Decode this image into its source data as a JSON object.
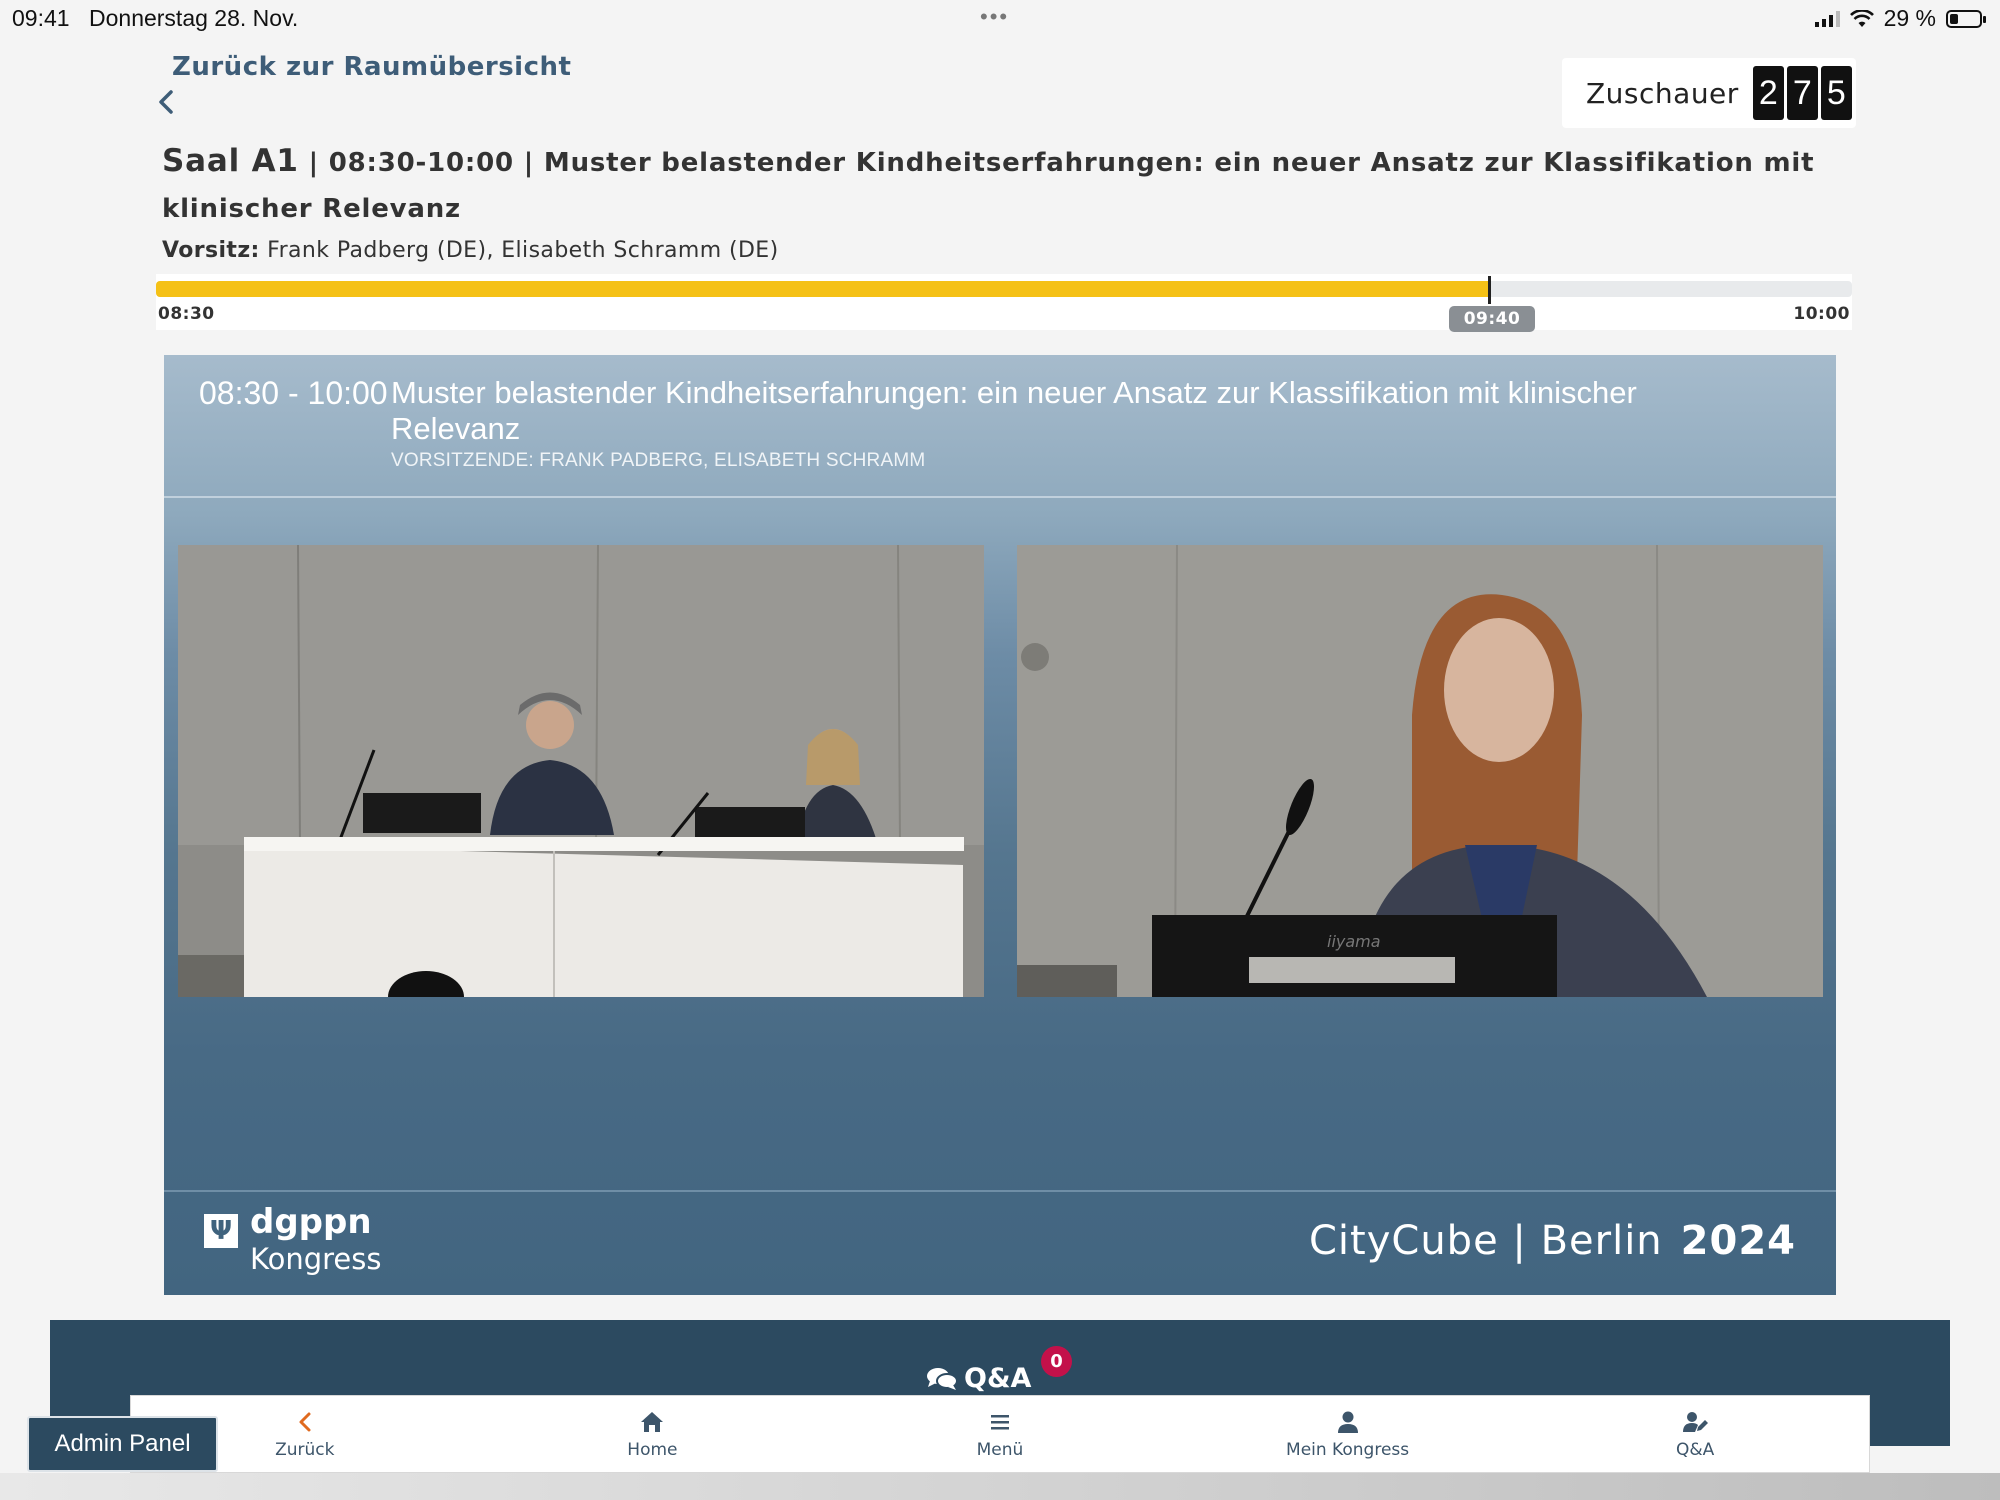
{
  "status_bar": {
    "time": "09:41",
    "date": "Donnerstag 28. Nov.",
    "battery": "29 %",
    "battery_level": 0.29
  },
  "header": {
    "back_label": "Zurück zur Raumübersicht",
    "viewers_label": "Zuschauer",
    "viewers_digits": [
      "2",
      "7",
      "5"
    ],
    "room": "Saal A1",
    "time_range": "08:30-10:00",
    "title": "Muster belastender Kindheitserfahrungen: ein neuer Ansatz zur Klassifikation mit klinischer Relevanz",
    "chair_label": "Vorsitz:",
    "chair_names": "Frank Padberg (DE), Elisabeth Schramm (DE)"
  },
  "timeline": {
    "start": "08:30",
    "end": "10:00",
    "now": "09:40",
    "progress": 0.786,
    "accent_color": "#f5c116"
  },
  "player": {
    "time_range": "08:30 - 10:00",
    "title": "Muster belastender Kindheitserfahrungen: ein neuer Ansatz zur Klassifikation mit klinischer Relevanz",
    "chair_line": "VORSITZENDE: FRANK PADBERG, ELISABETH SCHRAMM",
    "cameras": [
      {
        "name": "panel-camera",
        "description_icon": "panel-table-icon"
      },
      {
        "name": "speaker-camera",
        "description_icon": "speaker-podium-icon",
        "monitor_brand": "iiyama"
      }
    ],
    "logo_name": "dgppn",
    "logo_sub": "Kongress",
    "venue": "CityCube | Berlin",
    "year": "2024"
  },
  "qa": {
    "title": "Q&A",
    "count": "0",
    "badge_color": "#c3114a"
  },
  "bottom_nav": {
    "items": [
      {
        "label": "Zurück",
        "icon": "chevron-left-icon"
      },
      {
        "label": "Home",
        "icon": "home-icon"
      },
      {
        "label": "Menü",
        "icon": "menu-icon"
      },
      {
        "label": "Mein Kongress",
        "icon": "user-icon"
      },
      {
        "label": "Q&A",
        "icon": "user-edit-icon"
      }
    ]
  },
  "admin_button": "Admin Panel"
}
